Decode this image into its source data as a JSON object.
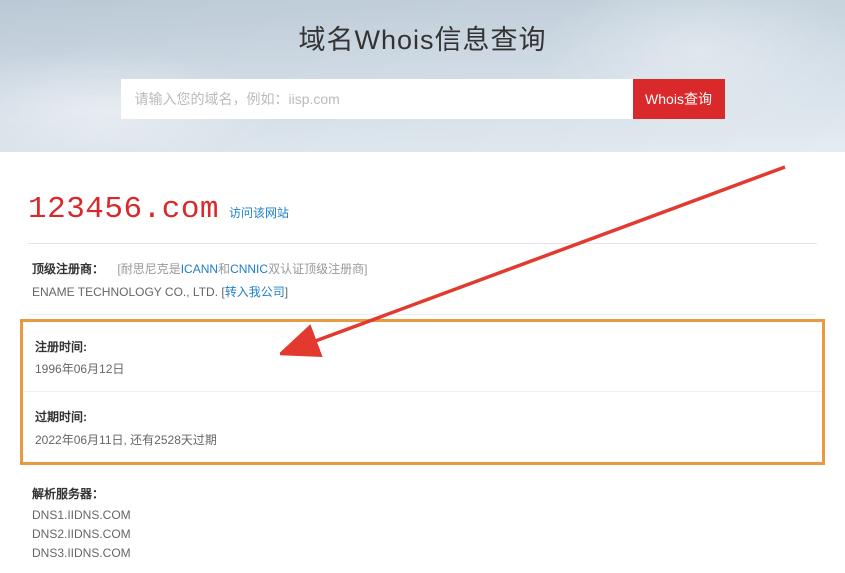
{
  "hero": {
    "title": "域名Whois信息查询",
    "search_placeholder": "请输入您的域名，例如：iisp.com",
    "search_button": "Whois查询"
  },
  "result": {
    "domain": "123456.com",
    "visit_label": "访问该网站"
  },
  "registrar": {
    "label": "顶级注册商：",
    "note_prefix": "[耐思尼克是",
    "icann": "ICANN",
    "and": "和",
    "cnnic": "CNNIC",
    "note_suffix": "双认证顶级注册商]",
    "company": "ENAME TECHNOLOGY CO., LTD. [",
    "transfer": "转入我公司",
    "company_close": "]"
  },
  "dates": {
    "reg_label": "注册时间:",
    "reg_value": "1996年06月12日",
    "exp_label": "过期时间:",
    "exp_value": "2022年06月11日, 还有2528天过期"
  },
  "dns": {
    "label": "解析服务器：",
    "servers": [
      "DNS1.IIDNS.COM",
      "DNS2.IIDNS.COM",
      "DNS3.IIDNS.COM"
    ]
  }
}
